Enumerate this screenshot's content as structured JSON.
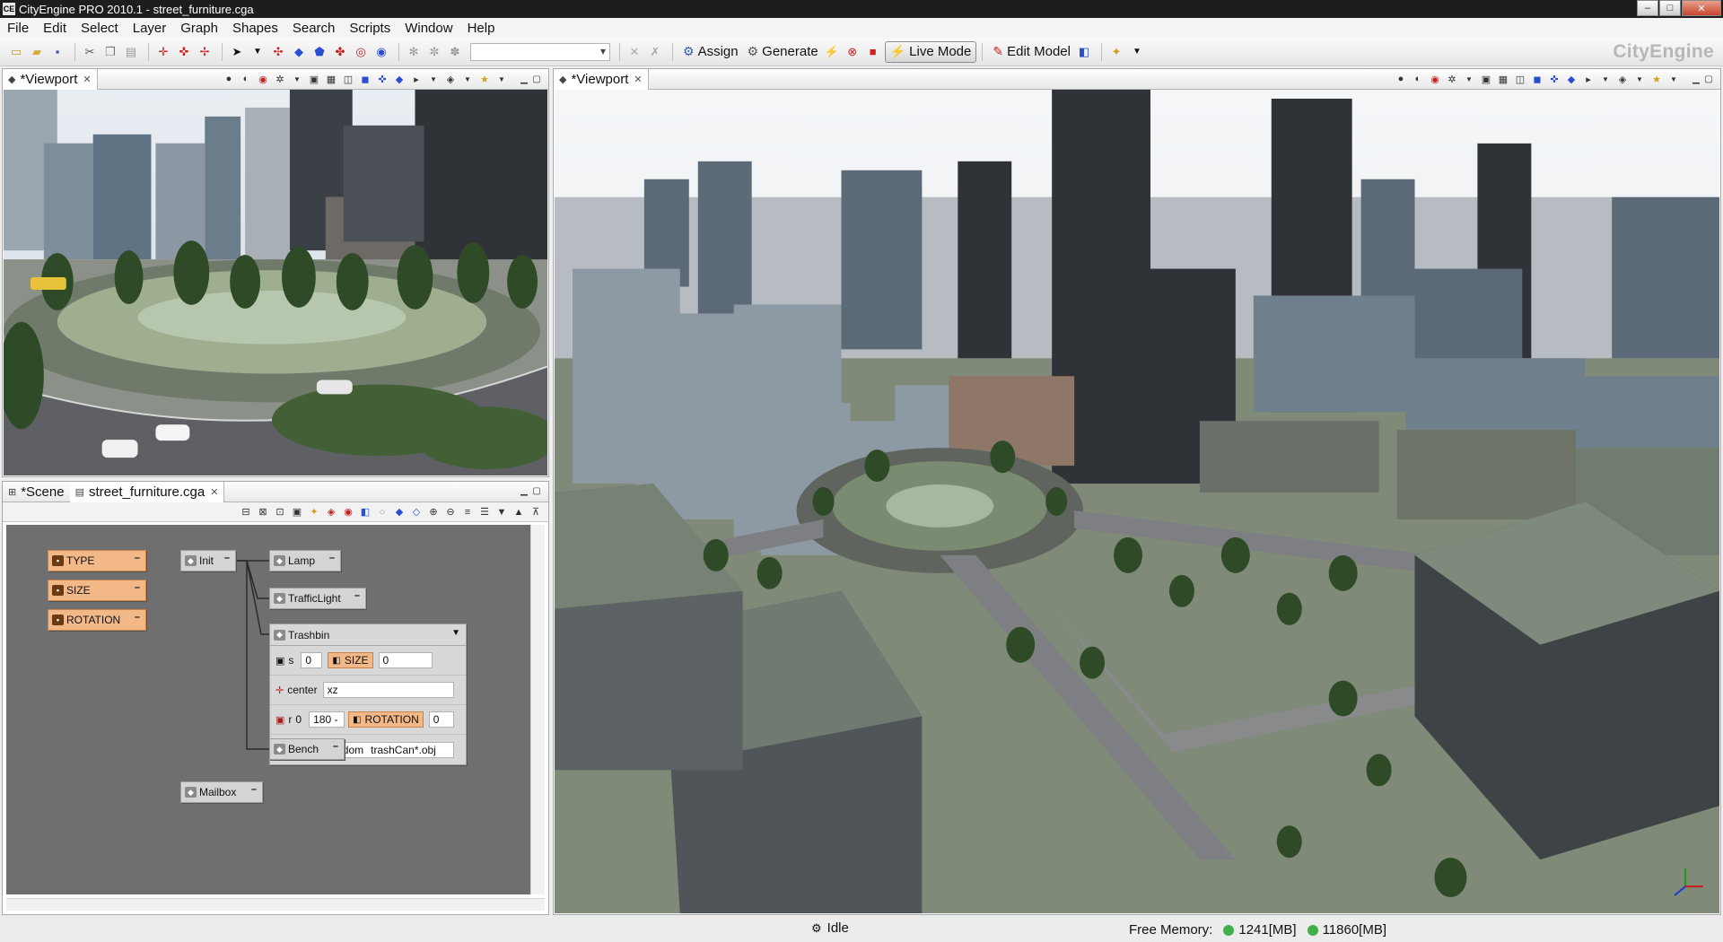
{
  "window": {
    "title": "CityEngine PRO 2010.1 - street_furniture.cga",
    "app_icon_text": "CE",
    "controls": {
      "minimize": "–",
      "maximize": "□",
      "close": "✕"
    }
  },
  "menu": [
    "File",
    "Edit",
    "Select",
    "Layer",
    "Graph",
    "Shapes",
    "Search",
    "Scripts",
    "Window",
    "Help"
  ],
  "toolbar": {
    "assign": "Assign",
    "generate": "Generate",
    "live_mode": "Live Mode",
    "edit_model": "Edit Model",
    "brand": "CityEngine"
  },
  "viewport_left": {
    "tab": "*Viewport"
  },
  "viewport_right": {
    "tab": "*Viewport"
  },
  "graph_panel": {
    "tabs": [
      "*Scene",
      "street_furniture.cga"
    ],
    "attributes": [
      "TYPE",
      "SIZE",
      "ROTATION"
    ],
    "nodes": {
      "init": "Init",
      "lamp": "Lamp",
      "traffic_light": "TrafficLight",
      "trashbin": "Trashbin",
      "bench": "Bench",
      "mailbox": "Mailbox"
    },
    "trashbin_rows": {
      "s_label": "s",
      "s_x": "0",
      "s_attr": "SIZE",
      "s_z": "0",
      "center_label": "center",
      "center_value": "xz",
      "r_label": "r",
      "r_x": "0",
      "r_y": "180 -",
      "r_attr": "ROTATION",
      "r_z": "0",
      "i_label": "i",
      "i_func": "fileRandom",
      "i_value": "trashCan*.obj"
    }
  },
  "status": {
    "state": "Idle",
    "free_memory_label": "Free Memory:",
    "mem1": "1241[MB]",
    "mem2": "11860[MB]"
  },
  "colors": {
    "attr_fill": "#f3b887",
    "graph_bg": "#6f6f6f",
    "memory_ok": "#3fb04a",
    "titlebar": "#1d1d1d"
  }
}
